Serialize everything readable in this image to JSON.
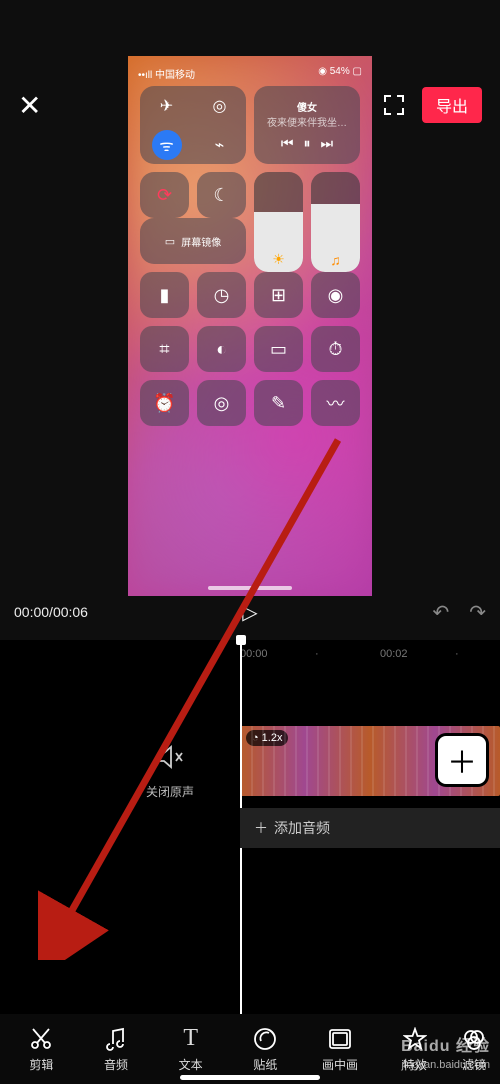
{
  "topbar": {
    "export_label": "导出"
  },
  "preview": {
    "status_carrier": "••ıll 中国移动",
    "status_wifi": "ᯤ",
    "status_battery": "54%",
    "music_title": "傻女",
    "music_sub": "夜来便来伴我坐…",
    "screen_label": "屏幕镜像"
  },
  "playback": {
    "current": "00:00",
    "total": "00:06"
  },
  "timeline": {
    "rulers": [
      "00:00",
      "00:02"
    ],
    "mute_label": "关闭原声",
    "speed_badge": "1.2x",
    "add_audio_label": "添加音频"
  },
  "toolbar": {
    "items": [
      {
        "icon": "cut",
        "label": "剪辑"
      },
      {
        "icon": "music",
        "label": "音频"
      },
      {
        "icon": "text",
        "label": "文本"
      },
      {
        "icon": "sticker",
        "label": "贴纸"
      },
      {
        "icon": "pip",
        "label": "画中画"
      },
      {
        "icon": "star",
        "label": "特效"
      },
      {
        "icon": "filter",
        "label": "滤镜"
      }
    ]
  },
  "watermark": {
    "brand": "Baidu 经验",
    "url": "jingyan.baidu.com"
  }
}
